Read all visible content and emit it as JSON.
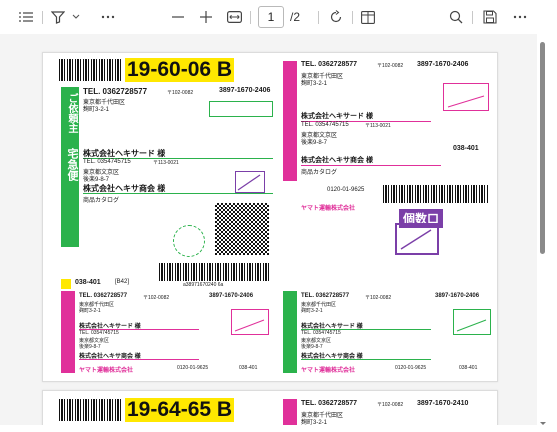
{
  "toolbar": {
    "page_current": "1",
    "page_total": "/2",
    "icons": [
      "list-icon",
      "filter-icon",
      "chevron-down-icon",
      "more-icon",
      "zoom-out-icon",
      "zoom-in-icon",
      "fit-width-icon",
      "rotate-icon",
      "two-page-icon",
      "search-icon",
      "save-icon",
      "more-icon"
    ]
  },
  "page1": {
    "big_code": "19-60-06 B",
    "tel1": "TEL. 0362728577",
    "zip_a": "〒102-0082",
    "phone_big": "3897-1670-2406",
    "addr_a1": "東京都千代田区",
    "addr_a2": "麹町3-2-1",
    "company1": "株式会社ヘキサード 様",
    "tel2": "TEL. 0354745715",
    "zip_b": "〒113-0021",
    "addr_b1": "東京都文京区",
    "addr_b2": "後楽9-8-7",
    "company2": "株式会社ヘキサ商会 様",
    "item": "商品カタログ",
    "small_code": "038-401",
    "small_code_suffix": "[B42]",
    "yamato": "ヤマト運輸株式会社",
    "phone_small": "0120-01-9625",
    "barcode_number": "a38971670240 6a",
    "kosu": "個数口",
    "dept_label": "ご依頼主",
    "bin_label": "宅急便"
  },
  "page2": {
    "big_code": "19-64-65 B",
    "tel1": "TEL. 0362728577",
    "zip_a": "〒102-0082",
    "phone_big": "3897-1670-2410",
    "addr_a1": "東京都千代田区",
    "addr_a2": "麹町3-2-1"
  },
  "colors": {
    "green": "#2bb24c",
    "pink": "#e0309a",
    "yellow": "#ffe800",
    "purple": "#7b3fa8"
  }
}
